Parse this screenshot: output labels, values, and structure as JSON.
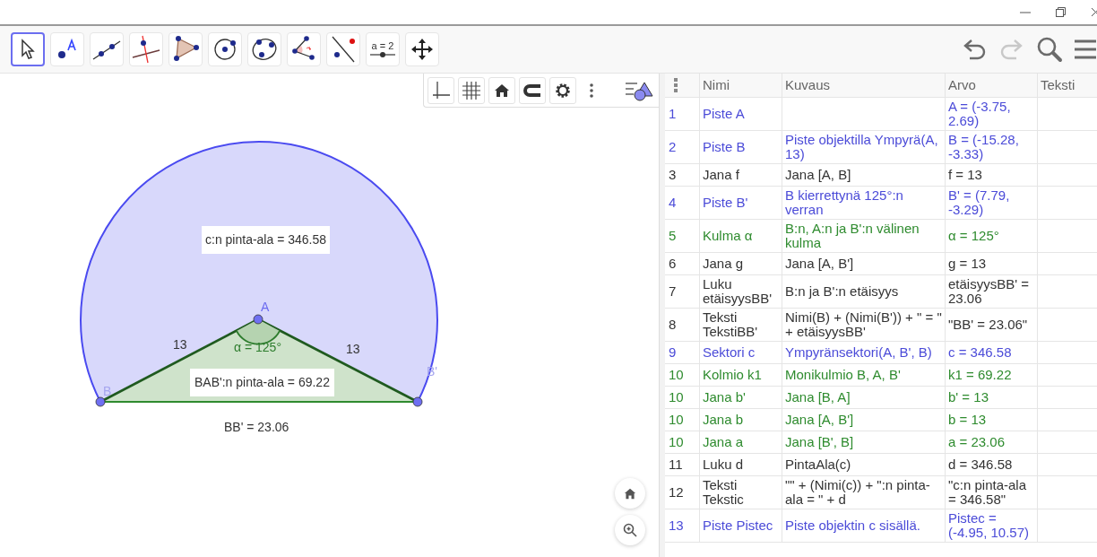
{
  "toolbar": {
    "tools": [
      {
        "kind": "move",
        "selected": true
      },
      {
        "kind": "point",
        "selected": false
      },
      {
        "kind": "line",
        "selected": false
      },
      {
        "kind": "perpendicular",
        "selected": false
      },
      {
        "kind": "polygon",
        "selected": false
      },
      {
        "kind": "circle",
        "selected": false
      },
      {
        "kind": "conic",
        "selected": false
      },
      {
        "kind": "angle",
        "selected": false
      },
      {
        "kind": "reflect",
        "selected": false
      },
      {
        "kind": "slider",
        "selected": false,
        "label": "a = 2"
      },
      {
        "kind": "pan",
        "selected": false
      }
    ],
    "actions": [
      {
        "kind": "undo",
        "disabled": false
      },
      {
        "kind": "redo",
        "disabled": true
      },
      {
        "kind": "search",
        "disabled": false
      },
      {
        "kind": "menu",
        "disabled": false
      }
    ]
  },
  "graphics": {
    "point_labels": [
      "A",
      "B",
      "B'"
    ],
    "segment_labels": [
      "13",
      "13"
    ],
    "angle_label": "α = 125°",
    "sector_caption": "c:n pinta-ala = 346.58",
    "triangle_caption": "BAB':n pinta-ala = 69.22",
    "distance_caption": "BB' = 23.06"
  },
  "table": {
    "columns": [
      "Nimi",
      "Kuvaus",
      "Arvo",
      "Teksti"
    ],
    "rows": [
      {
        "number": "1",
        "name": "Piste A",
        "description": "",
        "value": "A = (-3.75, 2.69)",
        "color": "#4b4bd8"
      },
      {
        "number": "2",
        "name": "Piste B",
        "description": "Piste objektilla Ympyrä(A, 13)",
        "value": "B = (-15.28, -3.33)",
        "color": "#4b4bd8"
      },
      {
        "number": "3",
        "name": "Jana f",
        "description": "Jana [A, B]",
        "value": "f = 13",
        "color": "#333333"
      },
      {
        "number": "4",
        "name": "Piste B'",
        "description": "B kierrettynä 125°:n verran",
        "value": "B' = (7.79, -3.29)",
        "color": "#4b4bd8"
      },
      {
        "number": "5",
        "name": "Kulma α",
        "description": "B:n, A:n ja B':n välinen kulma",
        "value": "α = 125°",
        "color": "#2e8b2e"
      },
      {
        "number": "6",
        "name": "Jana g",
        "description": "Jana [A, B']",
        "value": "g = 13",
        "color": "#333333"
      },
      {
        "number": "7",
        "name": "Luku etäisyysBB'",
        "description": "B:n ja B':n etäisyys",
        "value": "etäisyysBB' = 23.06",
        "color": "#333333"
      },
      {
        "number": "8",
        "name": "Teksti TekstiBB'",
        "description": "Nimi(B) + (Nimi(B')) + \" = \" + etäisyysBB'",
        "value": "\"BB' = 23.06\"",
        "color": "#333333"
      },
      {
        "number": "9",
        "name": "Sektori c",
        "description": "Ympyränsektori(A, B', B)",
        "value": "c = 346.58",
        "color": "#4b4bd8"
      },
      {
        "number": "10",
        "name": "Kolmio k1",
        "description": "Monikulmio B, A, B'",
        "value": "k1 = 69.22",
        "color": "#2e8b2e"
      },
      {
        "number": "10",
        "name": "Jana b'",
        "description": "Jana [B, A]",
        "value": "b' = 13",
        "color": "#2e8b2e"
      },
      {
        "number": "10",
        "name": "Jana b",
        "description": "Jana [A, B']",
        "value": "b = 13",
        "color": "#2e8b2e"
      },
      {
        "number": "10",
        "name": "Jana a",
        "description": "Jana [B', B]",
        "value": "a = 23.06",
        "color": "#2e8b2e"
      },
      {
        "number": "11",
        "name": "Luku d",
        "description": "PintaAla(c)",
        "value": "d = 346.58",
        "color": "#333333"
      },
      {
        "number": "12",
        "name": "Teksti Tekstic",
        "description": "\"\" + (Nimi(c)) + \":n pinta-ala = \" + d",
        "value": "\"c:n pinta-ala = 346.58\"",
        "color": "#333333"
      },
      {
        "number": "13",
        "name": "Piste Pistec",
        "description": "Piste objektin c sisällä.",
        "value": "Pistec = (-4.95, 10.57)",
        "color": "#4b4bd8"
      }
    ]
  }
}
